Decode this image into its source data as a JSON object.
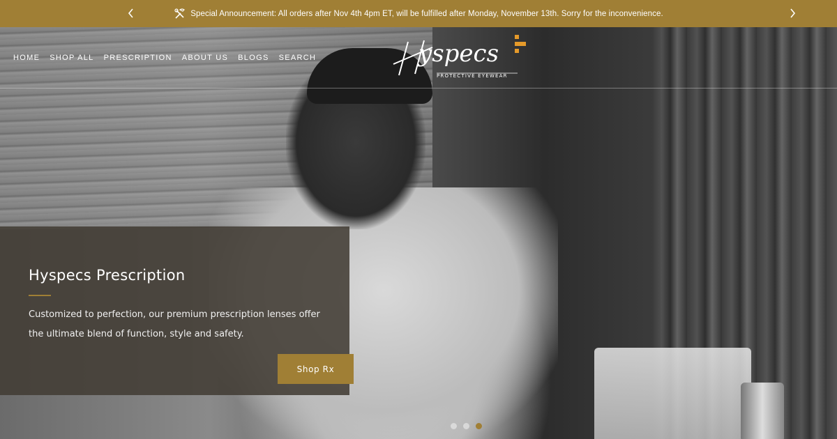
{
  "announcement": {
    "text": "Special Announcement: All orders after Nov 4th 4pm ET, will be fulfilled after Monday, November 13th. Sorry for the inconvenience.",
    "icon": "tools-icon",
    "prev_icon": "chevron-left-icon",
    "next_icon": "chevron-right-icon"
  },
  "nav": {
    "items": [
      {
        "label": "HOME"
      },
      {
        "label": "SHOP ALL"
      },
      {
        "label": "PRESCRIPTION"
      },
      {
        "label": "ABOUT US"
      },
      {
        "label": "BLOGS"
      },
      {
        "label": "SEARCH"
      }
    ]
  },
  "logo": {
    "name": "Hyspecs",
    "tagline": "PROTECTIVE EYEWEAR"
  },
  "hero": {
    "title": "Hyspecs Prescription",
    "description": "Customized to perfection, our premium prescription lenses offer the ultimate blend of function, style and safety.",
    "cta_label": "Shop Rx",
    "slides_total": 3,
    "active_slide": 3
  },
  "colors": {
    "accent": "#a07f35",
    "panel": "#423c34"
  }
}
